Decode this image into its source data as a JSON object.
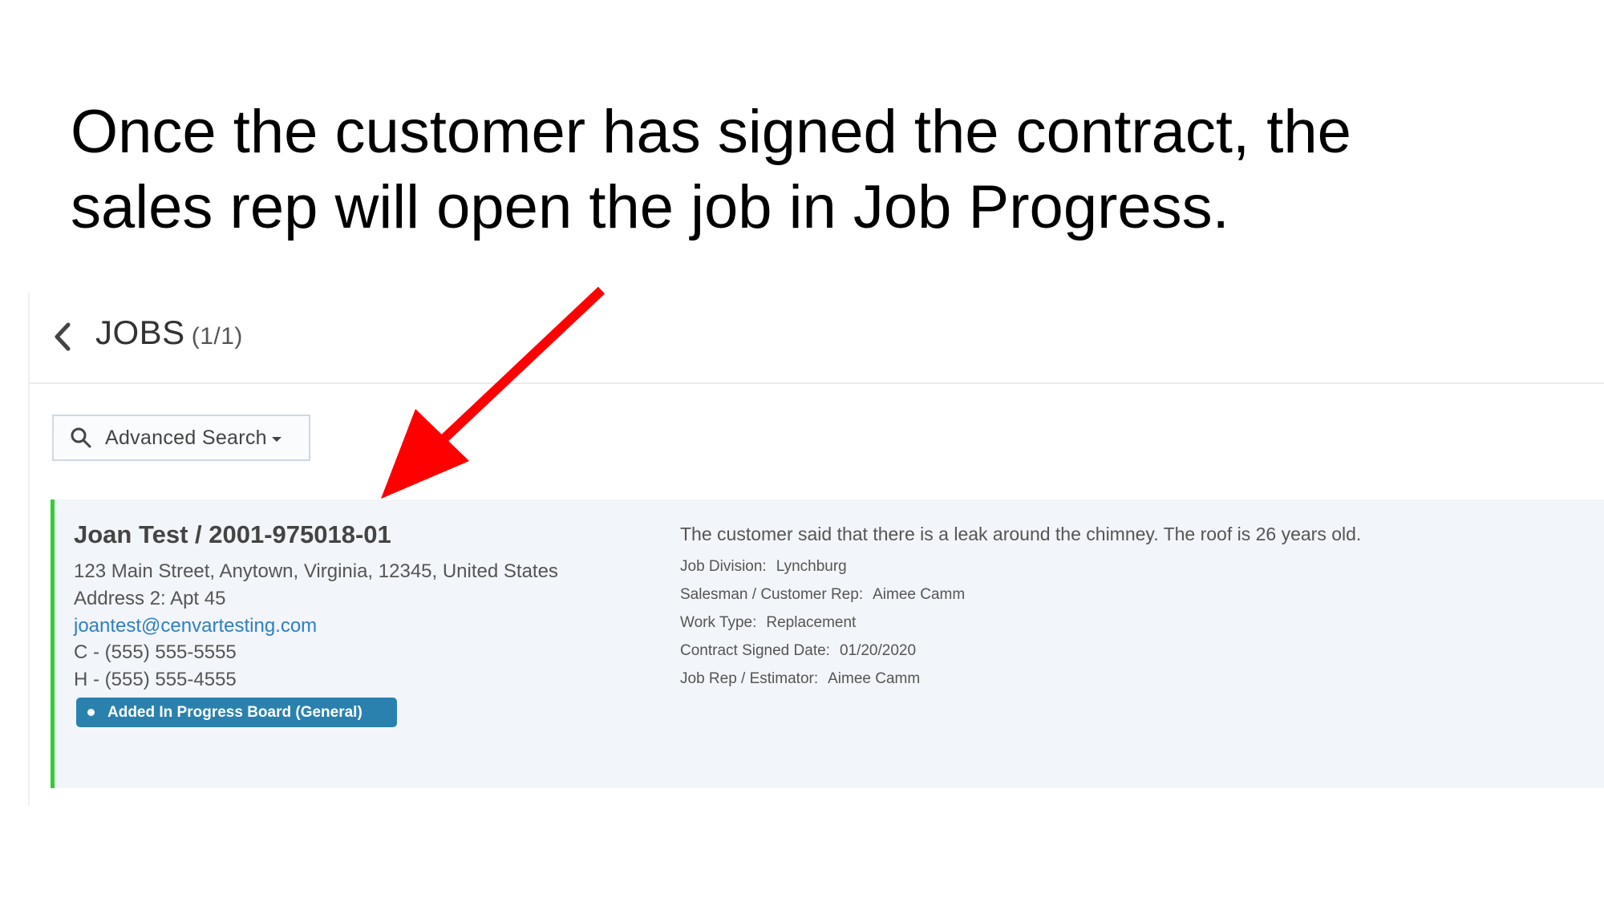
{
  "slide": {
    "title_line1": "Once the customer has signed the contract, the",
    "title_line2": "sales rep will open the job in Job Progress."
  },
  "jobs_header": {
    "title": "JOBS",
    "count": "(1/1)"
  },
  "search": {
    "label": "Advanced Search"
  },
  "job": {
    "title": "Joan Test / 2001-975018-01",
    "address": "123 Main Street, Anytown, Virginia, 12345, United States",
    "address2": "Address 2: Apt 45",
    "email": "joantest@cenvartesting.com",
    "cell_phone": "C - (555) 555-5555",
    "home_phone": "H - (555) 555-4555",
    "status_badge": "Added In Progress Board (General)",
    "description": "The customer said that there is a leak around the chimney. The roof is 26 years old.",
    "details": [
      {
        "label": "Job Division:",
        "value": "Lynchburg"
      },
      {
        "label": "Salesman / Customer Rep:",
        "value": "Aimee Camm"
      },
      {
        "label": "Work Type:",
        "value": "Replacement"
      },
      {
        "label": "Contract Signed Date:",
        "value": "01/20/2020"
      },
      {
        "label": "Job Rep / Estimator:",
        "value": "Aimee Camm"
      }
    ]
  },
  "annotation": {
    "arrow_color": "#ff0000"
  },
  "colors": {
    "accent_green": "#33cc33",
    "badge_blue": "#2a81ad",
    "link_blue": "#2f7fc4"
  }
}
